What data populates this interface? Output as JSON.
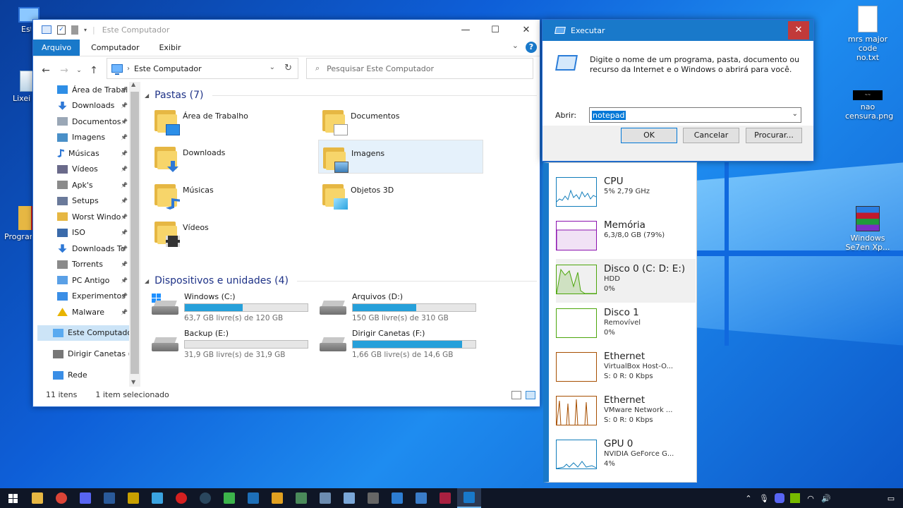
{
  "desktop": {
    "icons": [
      {
        "label": "Este Computador",
        "short": "Este\nComput"
      },
      {
        "label": "Lixeira",
        "short": "Lixeir"
      },
      {
        "label": "Programas",
        "short": "Progra"
      },
      {
        "label": "mrs major code no.txt"
      },
      {
        "label": "nao censura.png"
      },
      {
        "label": "Windows Se7en Xp..."
      }
    ]
  },
  "explorer": {
    "title": "Este Computador",
    "ribbon_tabs": [
      "Arquivo",
      "Computador",
      "Exibir"
    ],
    "help": "?",
    "address": "Este Computador",
    "search_placeholder": "Pesquisar Este Computador",
    "sidebar": [
      {
        "label": "Área de Trabal",
        "icon": "desktop-icon",
        "pinned": true
      },
      {
        "label": "Downloads",
        "icon": "download-icon",
        "pinned": true
      },
      {
        "label": "Documentos",
        "icon": "documents-icon",
        "pinned": true
      },
      {
        "label": "Imagens",
        "icon": "pictures-icon",
        "pinned": true
      },
      {
        "label": "Músicas",
        "icon": "music-icon",
        "pinned": true
      },
      {
        "label": "Vídeos",
        "icon": "videos-icon",
        "pinned": true
      },
      {
        "label": "Apk's",
        "icon": "drive-icon",
        "pinned": true
      },
      {
        "label": "Setups",
        "icon": "setup-icon",
        "pinned": true
      },
      {
        "label": "Worst Windo",
        "icon": "folder-icon",
        "pinned": true
      },
      {
        "label": "ISO",
        "icon": "iso-icon",
        "pinned": true
      },
      {
        "label": "Downloads To",
        "icon": "download-icon",
        "pinned": true
      },
      {
        "label": "Torrents",
        "icon": "drive-icon",
        "pinned": true
      },
      {
        "label": "PC Antigo",
        "icon": "computer-icon",
        "pinned": true
      },
      {
        "label": "Experimentos",
        "icon": "monitor-icon",
        "pinned": true
      },
      {
        "label": "Malware",
        "icon": "warning-icon",
        "pinned": true
      },
      {
        "label": "Este Computador",
        "icon": "this-pc-icon",
        "pinned": false
      },
      {
        "label": "Dirigir Canetas (F:",
        "icon": "usb-drive-icon",
        "pinned": false
      },
      {
        "label": "Rede",
        "icon": "network-icon",
        "pinned": false
      }
    ],
    "groups": {
      "folders_header": "Pastas (7)",
      "devices_header": "Dispositivos e unidades (4)"
    },
    "folders": [
      {
        "name": "Área de Trabalho",
        "badge": "desktop"
      },
      {
        "name": "Documentos",
        "badge": "document"
      },
      {
        "name": "Downloads",
        "badge": "download"
      },
      {
        "name": "Imagens",
        "badge": "picture"
      },
      {
        "name": "Músicas",
        "badge": "music"
      },
      {
        "name": "Objetos 3D",
        "badge": "cube"
      },
      {
        "name": "Vídeos",
        "badge": "film"
      }
    ],
    "drives": [
      {
        "name": "Windows (C:)",
        "free": "63,7 GB livre(s) de 120 GB",
        "used_fraction": 0.47,
        "color": "#26a0da"
      },
      {
        "name": "Arquivos (D:)",
        "free": "150 GB livre(s) de 310 GB",
        "used_fraction": 0.52,
        "color": "#26a0da"
      },
      {
        "name": "Backup (E:)",
        "free": "31,9 GB livre(s) de 31,9 GB",
        "used_fraction": 0.0,
        "color": "#26a0da"
      },
      {
        "name": "Dirigir Canetas (F:)",
        "free": "1,66 GB livre(s) de 14,6 GB",
        "used_fraction": 0.89,
        "color": "#26a0da"
      }
    ],
    "status": {
      "items": "11 itens",
      "selected": "1 item selecionado"
    }
  },
  "run": {
    "title": "Executar",
    "close": "✕",
    "description": "Digite o nome de um programa, pasta, documento ou recurso da Internet e o Windows o abrirá para você.",
    "open_label": "Abrir:",
    "value": "notepad",
    "ok": "OK",
    "cancel": "Cancelar",
    "browse": "Procurar..."
  },
  "taskmgr": [
    {
      "title": "CPU",
      "l1": "5% 2,79 GHz",
      "l2": "",
      "color": "#117dbb"
    },
    {
      "title": "Memória",
      "l1": "6,3/8,0 GB (79%)",
      "l2": "",
      "color": "#8b12ae"
    },
    {
      "title": "Disco 0 (C: D: E:)",
      "l1": "HDD",
      "l2": "0%",
      "color": "#4da60c"
    },
    {
      "title": "Disco 1",
      "l1": "Removível",
      "l2": "0%",
      "color": "#4da60c"
    },
    {
      "title": "Ethernet",
      "l1": "VirtualBox Host-O...",
      "l2": "S: 0  R: 0 Kbps",
      "color": "#a74f01"
    },
    {
      "title": "Ethernet",
      "l1": "VMware Network ...",
      "l2": "S: 0  R: 0 Kbps",
      "color": "#a74f01"
    },
    {
      "title": "GPU 0",
      "l1": "NVIDIA GeForce G...",
      "l2": "4%",
      "color": "#117dbb"
    }
  ],
  "colors": {
    "accent": "#1979ca",
    "selection": "#cce4f7",
    "taskbar": "#0f1626"
  }
}
